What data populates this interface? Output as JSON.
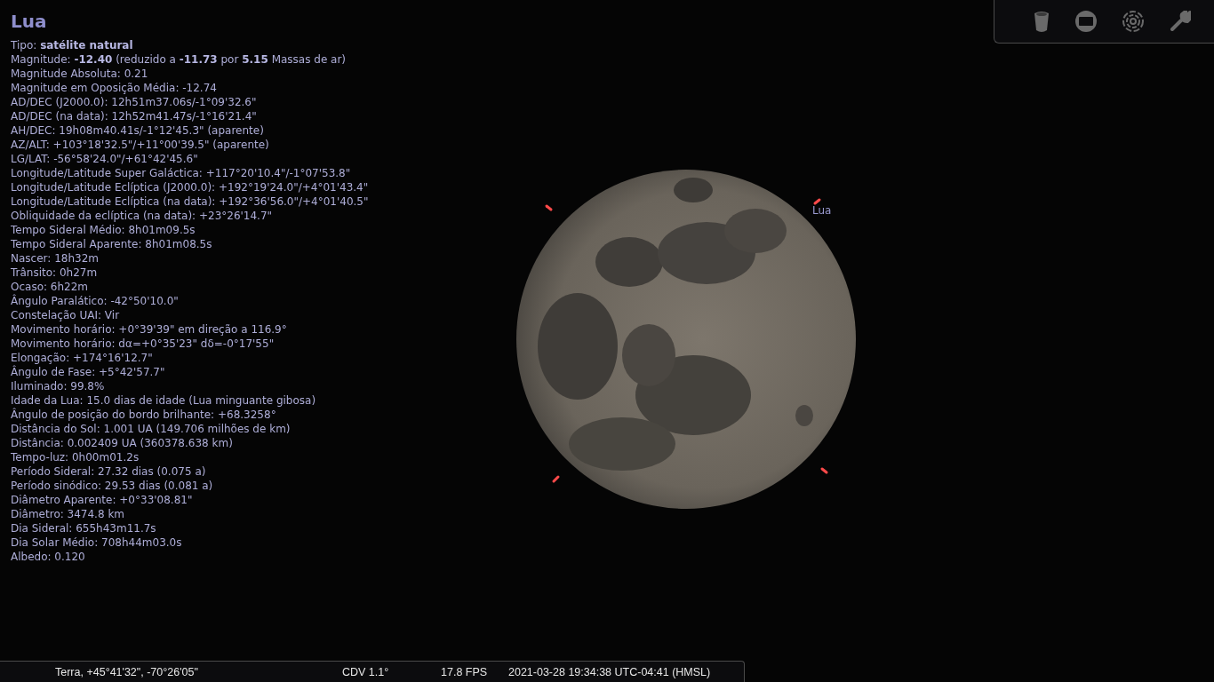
{
  "object_title": "Lua",
  "info_lines": [
    "Tipo: **satélite natural**",
    "Magnitude: **-12.40** (reduzido a **-11.73** por **5.15** Massas de ar)",
    "Magnitude Absoluta: 0.21",
    "Magnitude em Oposição Média: -12.74",
    "AD/DEC (J2000.0): 12h51m37.06s/-1°09'32.6\"",
    "AD/DEC (na data): 12h52m41.47s/-1°16'21.4\"",
    "AH/DEC: 19h08m40.41s/-1°12'45.3\" (aparente)",
    "AZ/ALT: +103°18'32.5\"/+11°00'39.5\" (aparente)",
    "LG/LAT: -56°58'24.0\"/+61°42'45.6\"",
    "Longitude/Latitude Super Galáctica: +117°20'10.4\"/-1°07'53.8\"",
    "Longitude/Latitude Eclíptica (J2000.0): +192°19'24.0\"/+4°01'43.4\"",
    "Longitude/Latitude Eclíptica (na data): +192°36'56.0\"/+4°01'40.5\"",
    "Obliquidade da eclíptica (na data): +23°26'14.7\"",
    "Tempo Sideral Médio: 8h01m09.5s",
    "Tempo Sideral Aparente: 8h01m08.5s",
    "Nascer: 18h32m",
    "Trânsito: 0h27m",
    "Ocaso: 6h22m",
    "Ângulo Paralático: -42°50'10.0\"",
    "Constelação UAI: Vir",
    "Movimento horário: +0°39'39\" em direção a 116.9°",
    "Movimento horário: dα=+0°35'23\" dδ=-0°17'55\"",
    "Elongação: +174°16'12.7\"",
    "Ângulo de Fase: +5°42'57.7\"",
    "Iluminado: 99.8%",
    "Idade da Lua: 15.0 dias de idade (Lua minguante gibosa)",
    "Ângulo de posição do bordo brilhante: +68.3258°",
    "Distância do Sol: 1.001 UA (149.706 milhões de km)",
    "Distância: 0.002409 UA (360378.638 km)",
    "Tempo-luz: 0h00m01.2s",
    "Período Sideral: 27.32 dias (0.075 a)",
    "Período sinódico: 29.53 dias (0.081 a)",
    "Diâmetro Aparente: +0°33'08.81\"",
    "Diâmetro: 3474.8 km",
    "Dia Sideral: 655h43m11.7s",
    "Dia Solar Médio: 708h44m03.0s",
    "Albedo: 0.120"
  ],
  "moon_label": "Lua",
  "status_bar": {
    "location": "Terra, +45°41'32\", -70°26'05\"",
    "fov": "CDV 1.1°",
    "fps": "17.8 FPS",
    "datetime": "2021-03-28 19:34:38 UTC-04:41 (HMSL)"
  }
}
